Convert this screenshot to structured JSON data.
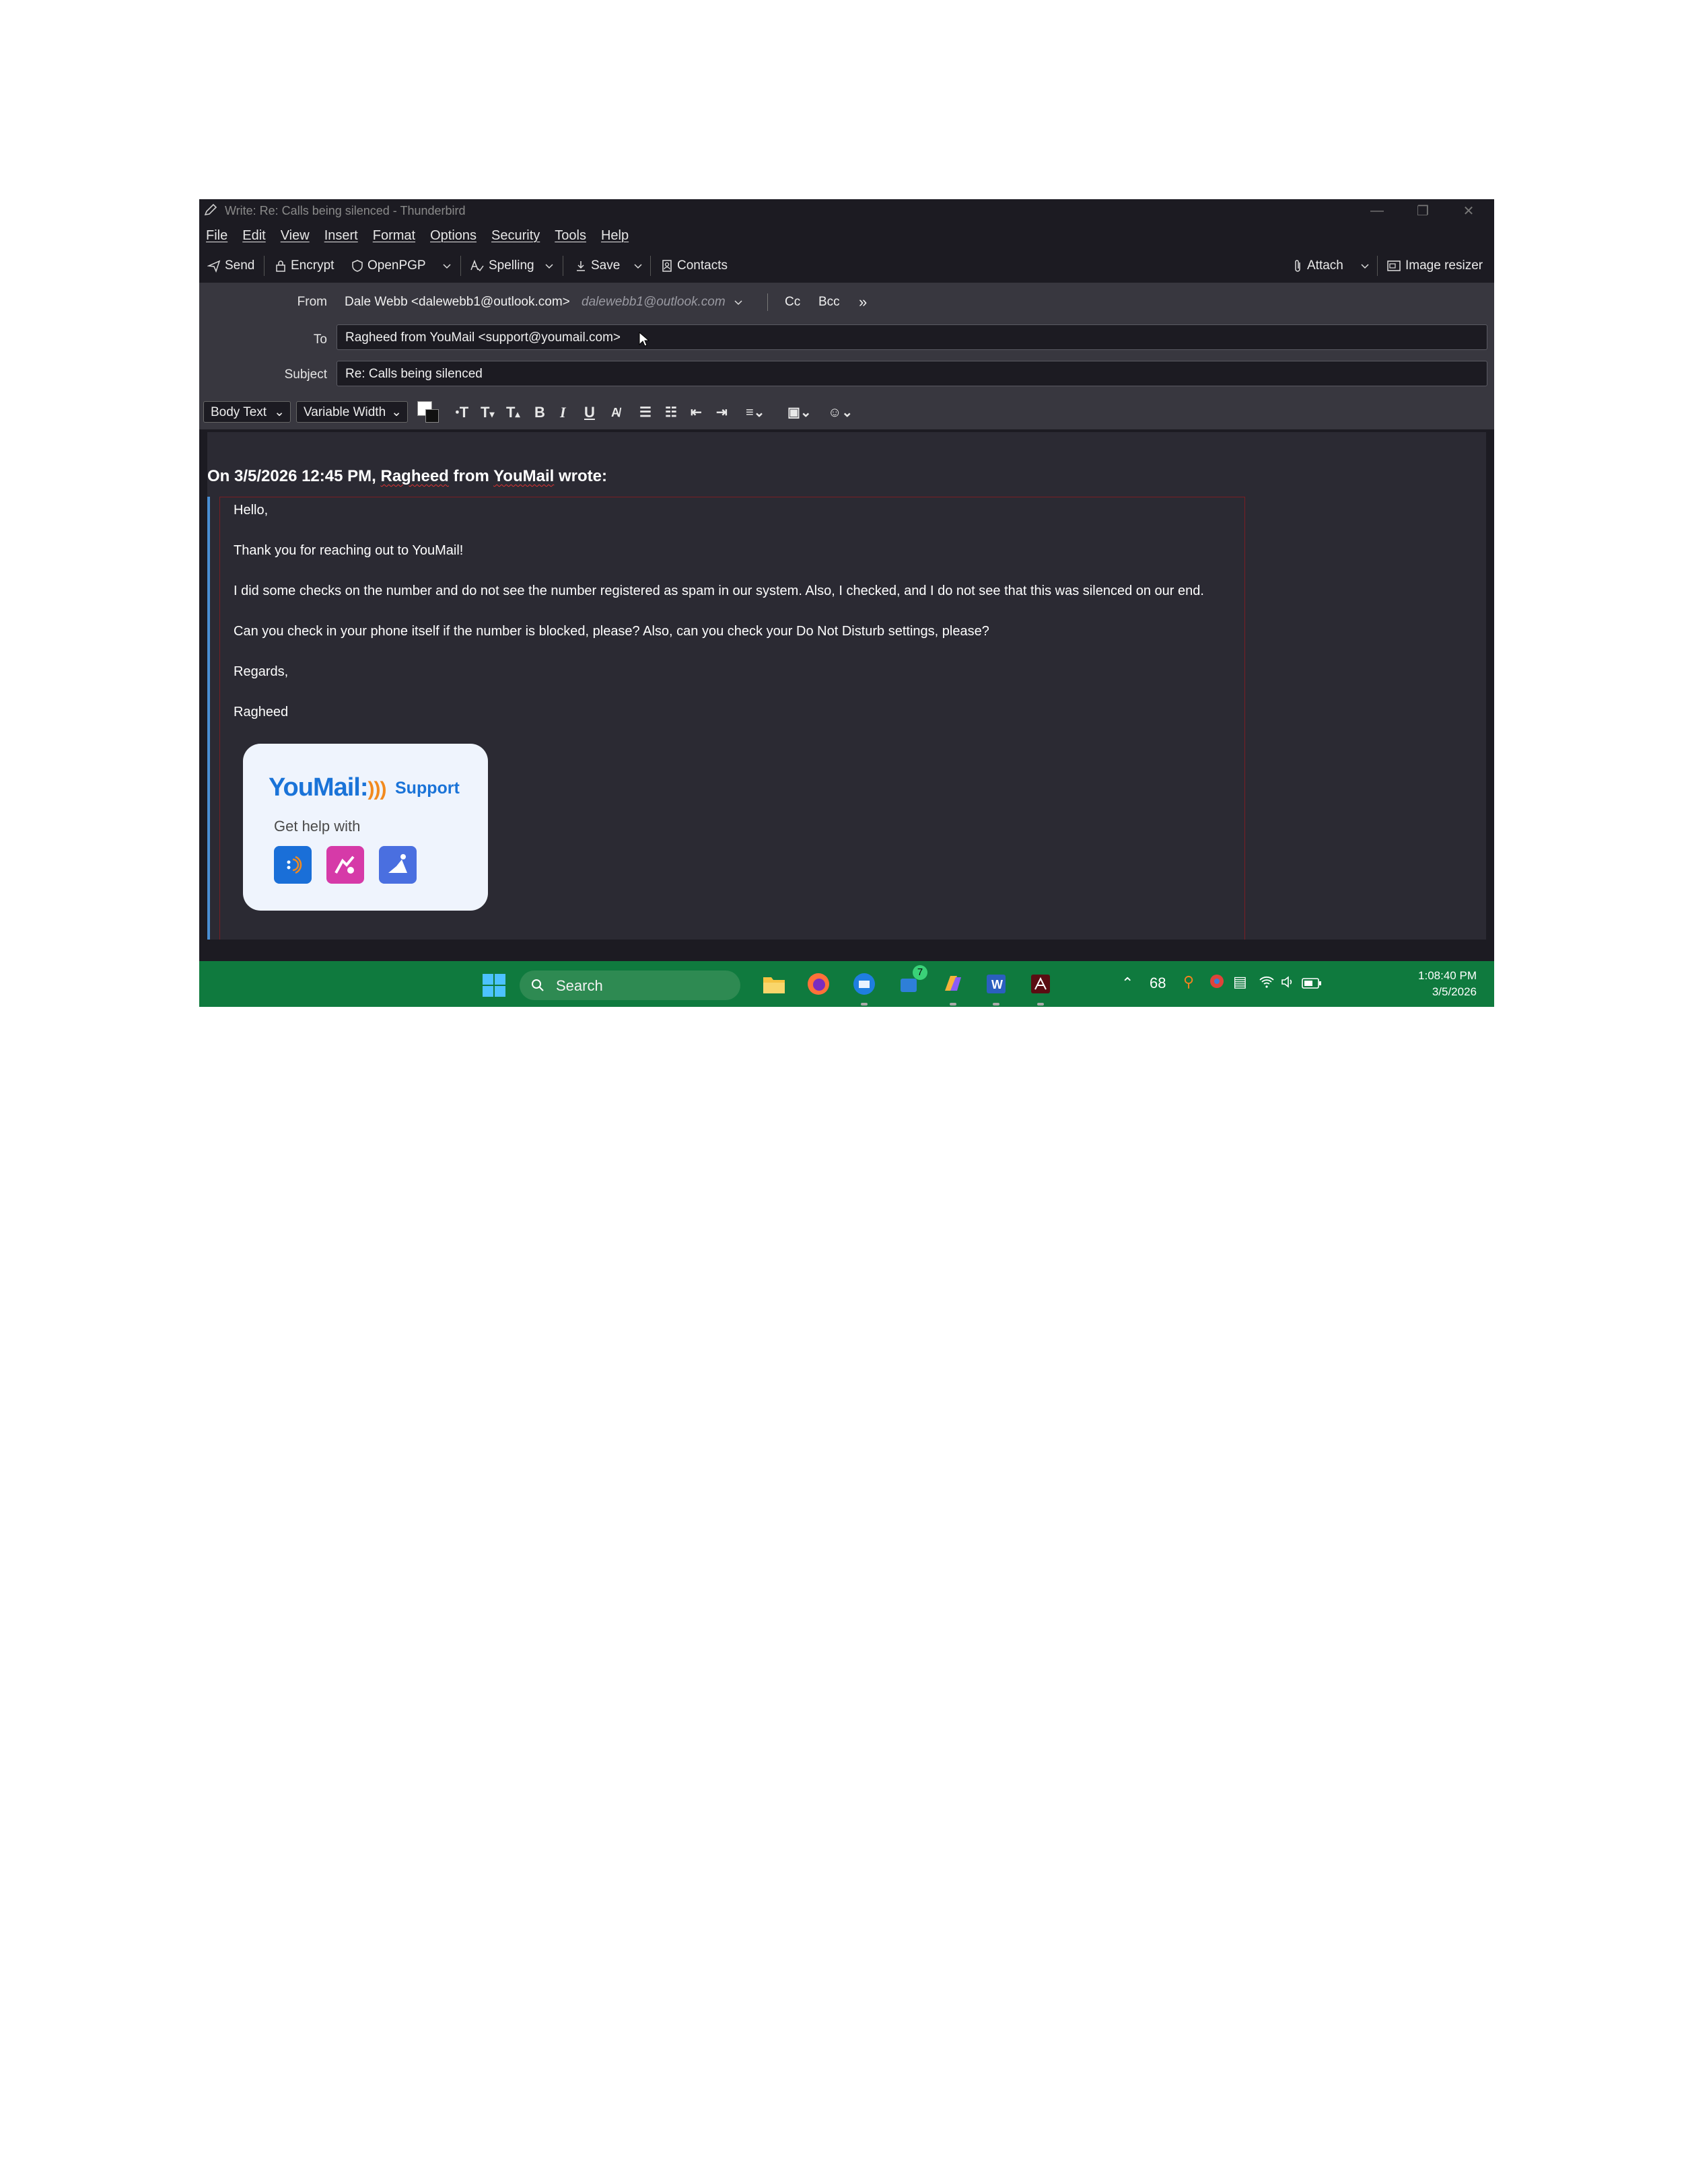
{
  "window": {
    "title": "Write: Re: Calls being silenced - Thunderbird"
  },
  "menu": [
    "File",
    "Edit",
    "View",
    "Insert",
    "Format",
    "Options",
    "Security",
    "Tools",
    "Help"
  ],
  "toolbar": {
    "send": "Send",
    "encrypt": "Encrypt",
    "openpgp": "OpenPGP",
    "spelling": "Spelling",
    "save": "Save",
    "contacts": "Contacts",
    "attach": "Attach",
    "image_resizer": "Image resizer"
  },
  "headers": {
    "from_label": "From",
    "from_value": "Dale Webb <dalewebb1@outlook.com>",
    "from_identity": "dalewebb1@outlook.com",
    "cc": "Cc",
    "bcc": "Bcc",
    "to_label": "To",
    "to_value": "Ragheed from YouMail <support@youmail.com>",
    "subject_label": "Subject",
    "subject_value": "Re: Calls being silenced"
  },
  "format": {
    "paragraph": "Body Text",
    "font": "Variable Width"
  },
  "message": {
    "cite_prefix": "On 3/5/2026 12:45 PM, ",
    "cite_name1": "Ragheed",
    "cite_from": " from ",
    "cite_name2": "YouMail",
    "cite_suffix": " wrote:",
    "lines": [
      "Hello,",
      "Thank you for reaching out to YouMail!",
      "I did some checks on the number and do not see the number registered as spam in our system. Also, I checked, and I do not see that this was silenced on our end.",
      "Can you check in your phone itself if the number is blocked, please? Also, can you check your Do Not Disturb settings, please?",
      "Regards,",
      "Ragheed"
    ],
    "card": {
      "logo": "YouMail:",
      "support": "Support",
      "get_help": "Get help with"
    }
  },
  "taskbar": {
    "search": "Search",
    "weather": "68",
    "badge": "7",
    "time": "1:08:40 PM",
    "date": "3/5/2026"
  },
  "colors": {
    "accent_blue": "#1a73d8",
    "taskbar_green": "#0f7a3e",
    "quote_border": "#7a1e24"
  }
}
